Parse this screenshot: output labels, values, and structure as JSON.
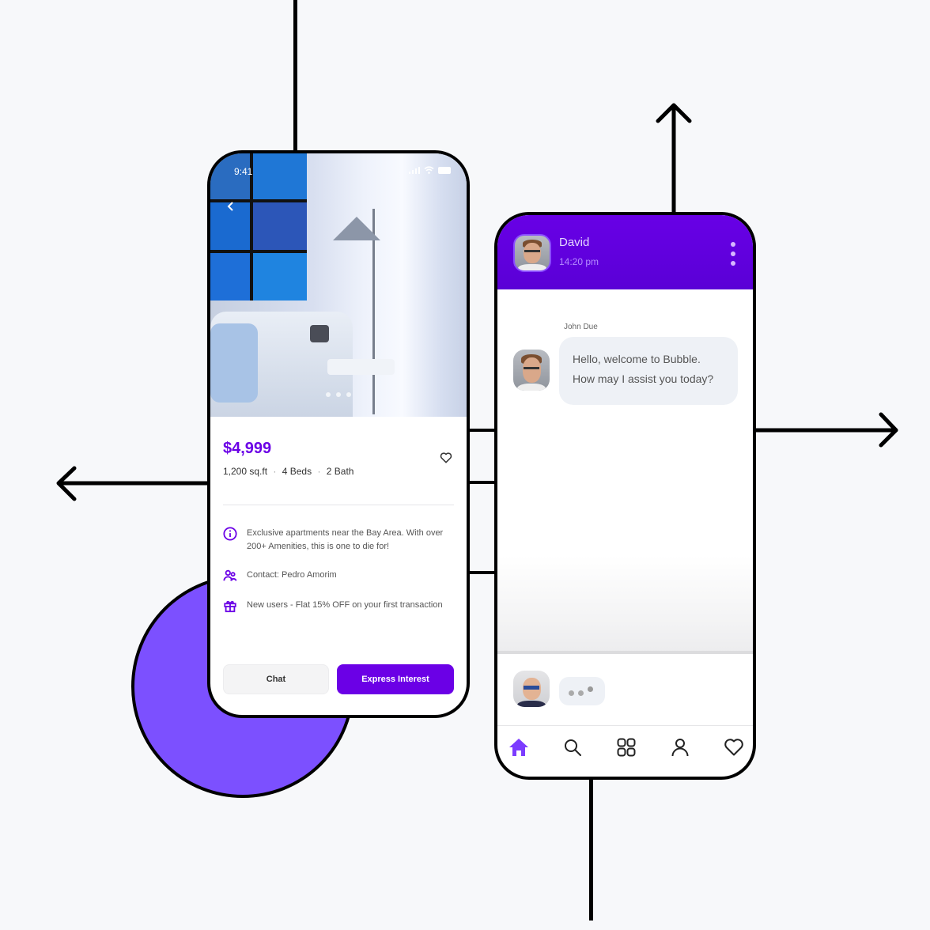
{
  "colors": {
    "background": "#f7f8fa",
    "accent": "#6b00e6",
    "circle": "#7c50ff",
    "header_purple": "#6000e0",
    "line": "#000000"
  },
  "listing_phone": {
    "status_bar": {
      "time": "9:41",
      "icons": [
        "signal-icon",
        "wifi-icon",
        "battery-icon"
      ]
    },
    "back_icon": "chevron-left-icon",
    "carousel": {
      "pages": 3,
      "active": 2
    },
    "price": "$4,999",
    "specs": {
      "area": "1,200 sq.ft",
      "beds": "4 Beds",
      "baths": "2 Bath",
      "separator": "·"
    },
    "favorite_icon": "heart-icon",
    "info_items": [
      {
        "icon": "info-icon",
        "text": "Exclusive apartments near the Bay Area. With over 200+ Amenities, this is one to die for!"
      },
      {
        "icon": "users-icon",
        "text": "Contact: Pedro Amorim"
      },
      {
        "icon": "gift-icon",
        "text": "New users - Flat 15% OFF on your first transaction"
      }
    ],
    "buttons": {
      "chat": "Chat",
      "express_interest": "Express Interest"
    }
  },
  "chat_phone": {
    "header": {
      "name": "David",
      "time": "14:20 pm",
      "menu_icon": "kebab-icon"
    },
    "messages": [
      {
        "sender": "John Due",
        "lines": [
          "Hello, welcome to Bubble.",
          "How may I assist you today?"
        ]
      }
    ],
    "typing_indicator": {
      "dots": 3
    },
    "nav": [
      {
        "name": "home",
        "icon": "home-icon",
        "active": true
      },
      {
        "name": "search",
        "icon": "search-icon",
        "active": false
      },
      {
        "name": "apps",
        "icon": "grid-icon",
        "active": false
      },
      {
        "name": "profile",
        "icon": "user-icon",
        "active": false
      },
      {
        "name": "favorites",
        "icon": "heart-icon",
        "active": false
      }
    ]
  }
}
